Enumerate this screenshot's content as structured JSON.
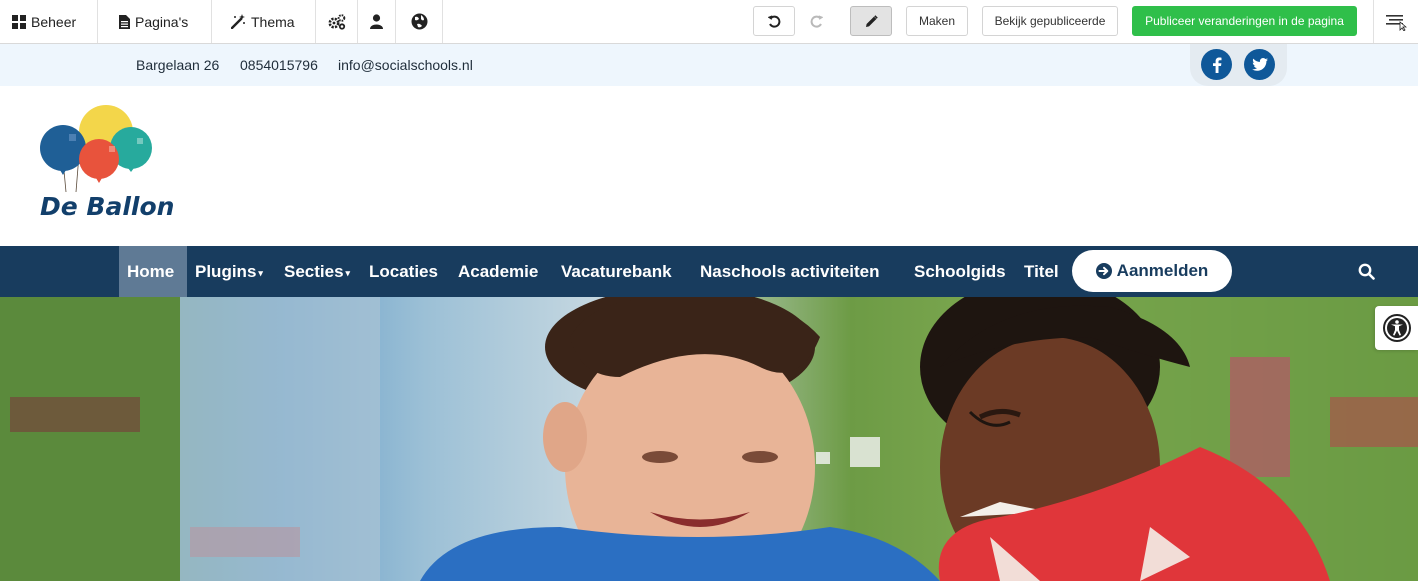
{
  "toolbar": {
    "beheer_label": "Beheer",
    "paginas_label": "Pagina's",
    "thema_label": "Thema",
    "maken_label": "Maken",
    "view_published_label": "Bekijk gepubliceerde",
    "publish_label": "Publiceer veranderingen in de pagina"
  },
  "contact": {
    "address": "Bargelaan 26",
    "phone": "0854015796",
    "email": "info@socialschools.nl"
  },
  "logo": {
    "name": "De Ballon"
  },
  "nav": {
    "items": [
      "Home",
      "Plugins",
      "Secties",
      "Locaties",
      "Academie",
      "Vacaturebank",
      "Naschools activiteiten",
      "Schoolgids",
      "Titel"
    ],
    "login_label": "Aanmelden"
  },
  "colors": {
    "nav_bg": "#183c5e",
    "nav_active": "#5f7a95",
    "publish_green": "#2fbf4a",
    "social_blue": "#0f5899",
    "contact_bg": "#eef6fd"
  },
  "icons": [
    "grid-icon",
    "page-icon",
    "magic-wand-icon",
    "gears-icon",
    "user-icon",
    "globe-icon",
    "undo-icon",
    "redo-icon",
    "pencil-icon",
    "hamburger-menu-icon",
    "facebook-icon",
    "twitter-icon",
    "arrow-circle-right-icon",
    "search-icon",
    "accessibility-icon"
  ]
}
